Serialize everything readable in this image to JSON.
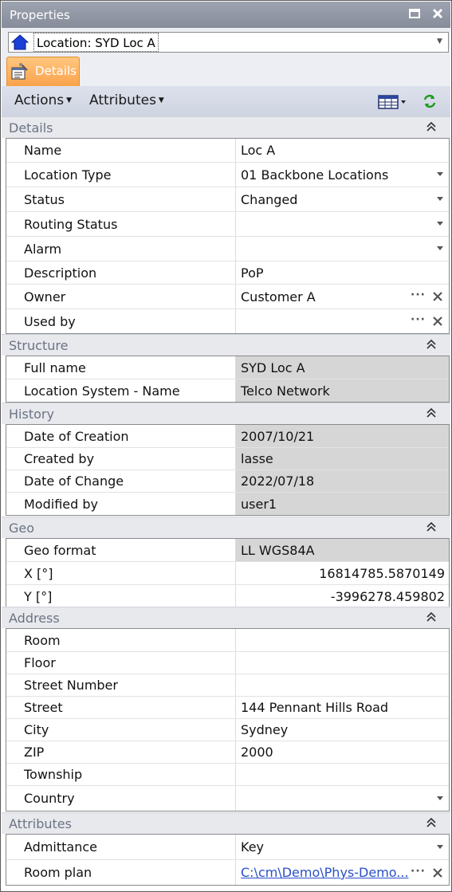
{
  "window": {
    "title": "Properties"
  },
  "selector": {
    "value": "Location: SYD Loc A",
    "icon": "home-icon"
  },
  "tabs": [
    {
      "label": "Details",
      "icon": "properties-icon",
      "active": true
    }
  ],
  "toolbar": {
    "actions_label": "Actions",
    "attributes_label": "Attributes",
    "grid_icon": "table-view-icon",
    "refresh_icon": "refresh-icon"
  },
  "colors": {
    "accent_tab": "#fba24d",
    "section_title": "#6b7383",
    "readonly_bg": "#d6d6d6",
    "link": "#2a4fc8"
  },
  "sections": {
    "details": {
      "title": "Details",
      "rows": [
        {
          "label": "Name",
          "value": "Loc A"
        },
        {
          "label": "Location Type",
          "value": "01 Backbone Locations"
        },
        {
          "label": "Status",
          "value": "Changed"
        },
        {
          "label": "Routing Status",
          "value": ""
        },
        {
          "label": "Alarm",
          "value": ""
        },
        {
          "label": "Description",
          "value": "PoP"
        },
        {
          "label": "Owner",
          "value": "Customer A"
        },
        {
          "label": "Used by",
          "value": ""
        }
      ]
    },
    "structure": {
      "title": "Structure",
      "rows": [
        {
          "label": "Full name",
          "value": "SYD Loc A"
        },
        {
          "label": "Location System - Name",
          "value": "Telco Network"
        }
      ]
    },
    "history": {
      "title": "History",
      "rows": [
        {
          "label": "Date of Creation",
          "value": "2007/10/21"
        },
        {
          "label": "Created by",
          "value": "lasse"
        },
        {
          "label": "Date of Change",
          "value": "2022/07/18"
        },
        {
          "label": "Modified by",
          "value": "user1"
        }
      ]
    },
    "geo": {
      "title": "Geo",
      "rows": [
        {
          "label": "Geo format",
          "value": "LL WGS84A"
        },
        {
          "label": "X [°]",
          "value": "16814785.5870149"
        },
        {
          "label": "Y [°]",
          "value": "-3996278.459802"
        }
      ]
    },
    "address": {
      "title": "Address",
      "rows": [
        {
          "label": "Room",
          "value": ""
        },
        {
          "label": "Floor",
          "value": ""
        },
        {
          "label": "Street Number",
          "value": ""
        },
        {
          "label": "Street",
          "value": "144 Pennant Hills Road"
        },
        {
          "label": "City",
          "value": "Sydney"
        },
        {
          "label": "ZIP",
          "value": "2000"
        },
        {
          "label": "Township",
          "value": ""
        },
        {
          "label": "Country",
          "value": ""
        }
      ]
    },
    "attributes": {
      "title": "Attributes",
      "rows": [
        {
          "label": "Admittance",
          "value": "Key"
        },
        {
          "label": "Room plan",
          "value": "C:\\cm\\Demo\\Phys-Demo..."
        }
      ]
    }
  }
}
